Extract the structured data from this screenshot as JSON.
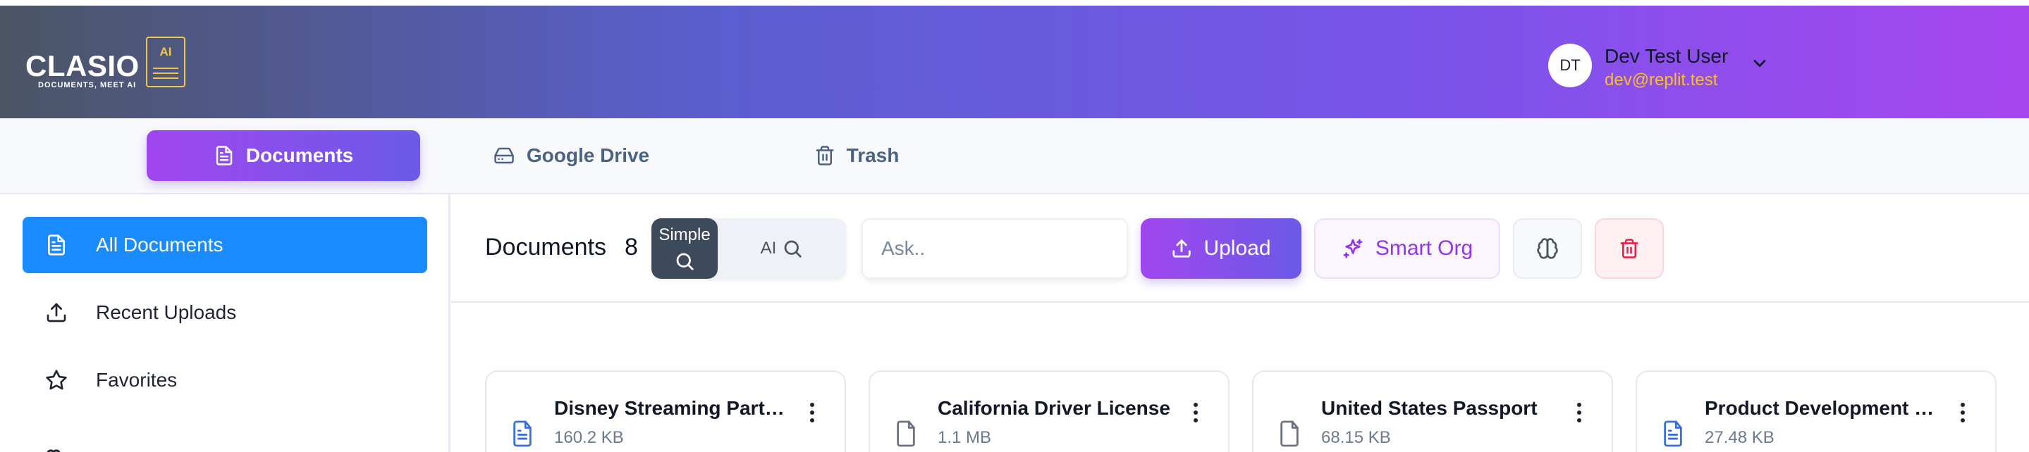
{
  "header": {
    "logo": {
      "word": "CLASIO",
      "tagline": "DOCUMENTS, MEET AI",
      "badge": "AI"
    },
    "user": {
      "initials": "DT",
      "name": "Dev Test User",
      "email": "dev@replit.test"
    },
    "colors": {
      "gradient_start": "#4b5565",
      "gradient_end": "#a646ef",
      "email": "#fbbf24"
    }
  },
  "tabs": [
    {
      "label": "Documents",
      "icon": "document-icon",
      "active": true
    },
    {
      "label": "Google Drive",
      "icon": "drive-icon",
      "active": false
    },
    {
      "label": "Trash",
      "icon": "trash-icon",
      "active": false
    }
  ],
  "sidebar": {
    "items": [
      {
        "label": "All Documents",
        "icon": "document-icon",
        "active": true
      },
      {
        "label": "Recent Uploads",
        "icon": "upload-icon",
        "active": false
      },
      {
        "label": "Favorites",
        "icon": "star-icon",
        "active": false
      }
    ]
  },
  "toolbar": {
    "title": "Documents",
    "count": "8",
    "search_mode": {
      "simple_label": "Simple",
      "ai_label": "AI",
      "selected": "Simple"
    },
    "ask_placeholder": "Ask..",
    "upload_label": "Upload",
    "smart_org_label": "Smart Org",
    "colors": {
      "accent": "#1a8cff",
      "purple": "#9333ea",
      "danger": "#e11d48"
    }
  },
  "documents": [
    {
      "name": "Disney Streaming Partnership",
      "size": "160.2 KB",
      "icon": "text-file-icon"
    },
    {
      "name": "California Driver License",
      "size": "1.1 MB",
      "icon": "file-icon"
    },
    {
      "name": "United States Passport",
      "size": "68.15 KB",
      "icon": "file-icon"
    },
    {
      "name": "Product Development Plan",
      "size": "27.48 KB",
      "icon": "text-file-icon"
    }
  ]
}
